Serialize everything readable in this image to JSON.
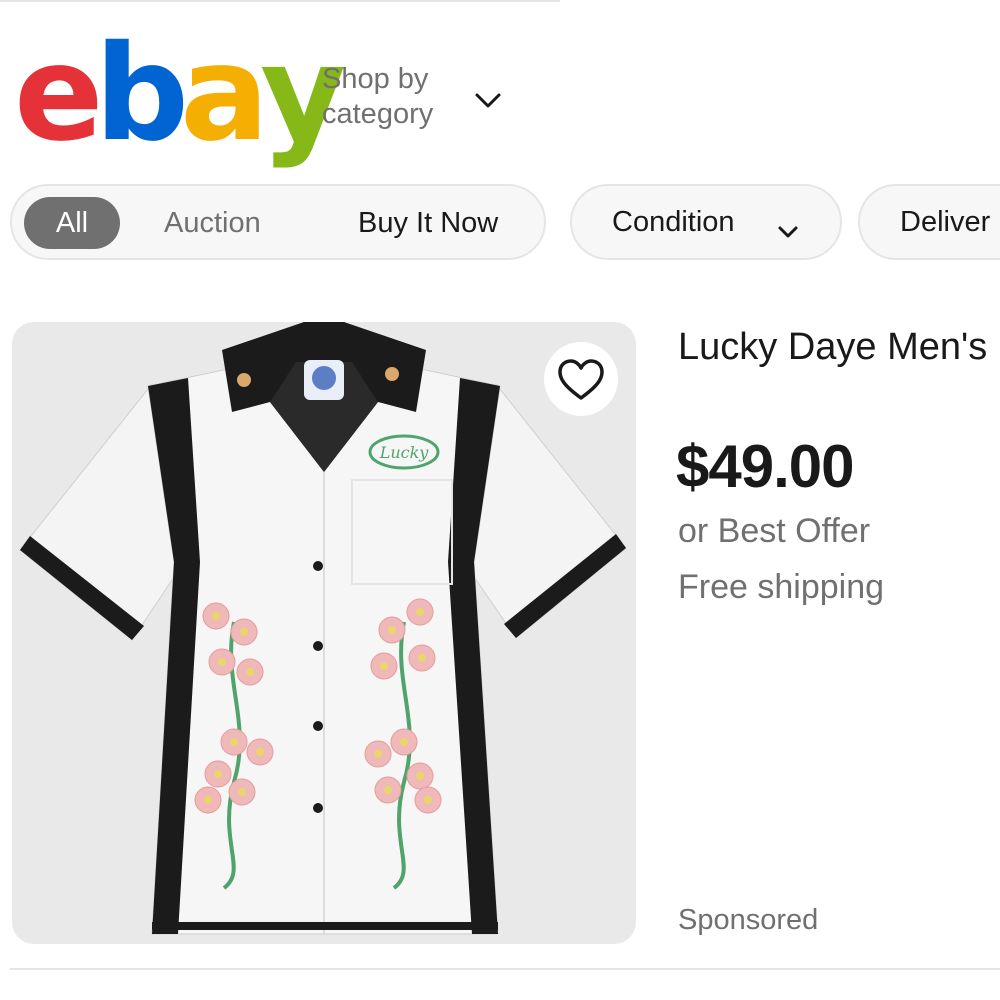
{
  "header": {
    "logo": {
      "letters": [
        "e",
        "b",
        "a",
        "y"
      ],
      "colors": [
        "#e53238",
        "#0064d2",
        "#f5af02",
        "#86b817"
      ]
    },
    "shop_by_line1": "Shop by",
    "shop_by_line2": "category",
    "shop_by_icon": "chevron-down-icon"
  },
  "filters": {
    "buying_format": [
      "All",
      "Auction",
      "Buy It Now"
    ],
    "selected": "All",
    "condition_label": "Condition",
    "condition_icon": "chevron-down-icon",
    "delivery_label": "Deliver"
  },
  "item": {
    "title": "Lucky Daye Men's",
    "price": "$49.00",
    "offer": "or Best Offer",
    "shipping": "Free shipping",
    "sponsored": "Sponsored",
    "image": {
      "description_icon": "shirt-image",
      "collar_patch": "Lucky"
    },
    "watch_icon": "heart-icon"
  },
  "colors": {
    "text_primary": "#191919",
    "text_secondary": "#707070",
    "chip_background": "#f7f7f7",
    "chip_border": "#e5e5e5",
    "selected_pill": "#707070",
    "image_background": "#e9e9e9"
  }
}
